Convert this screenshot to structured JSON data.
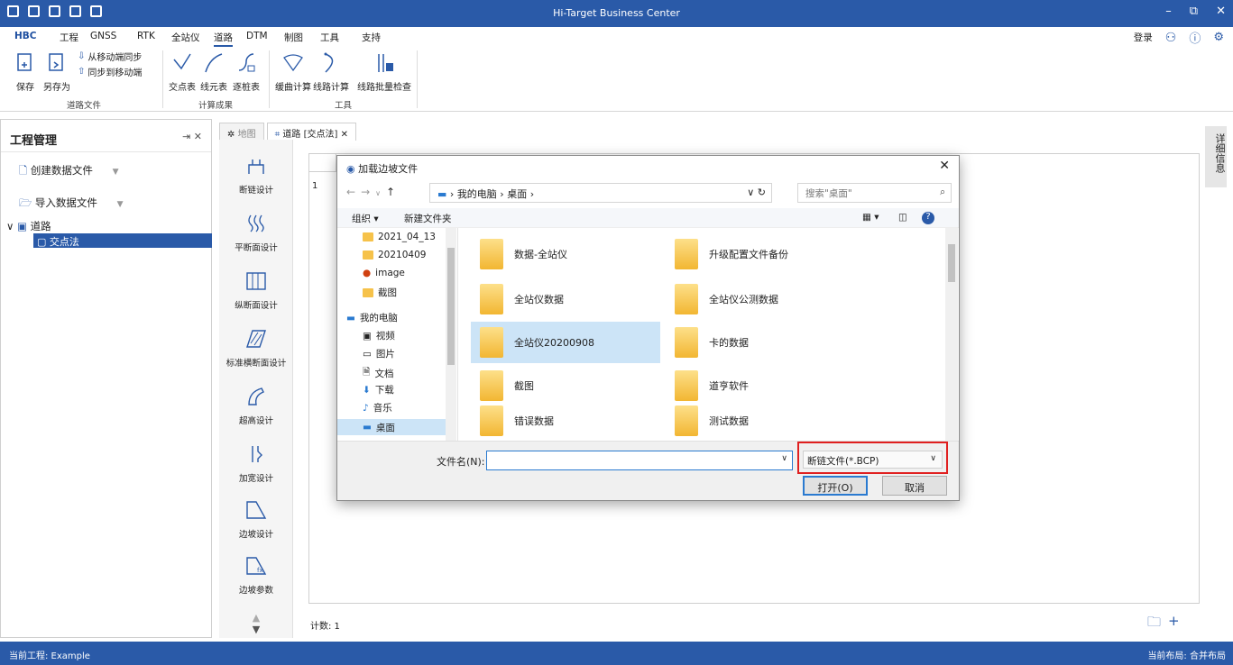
{
  "app": {
    "title": "Hi-Target Business Center"
  },
  "menu": [
    "HBC",
    "工程",
    "GNSS",
    "RTK",
    "全站仪",
    "道路",
    "DTM",
    "制图",
    "工具",
    "支持"
  ],
  "menu_active": "道路",
  "top_right": {
    "login": "登录"
  },
  "ribbon": {
    "save": "保存",
    "save_as": "另存为",
    "sync_from": "从移动端同步",
    "sync_to": "同步到移动端",
    "group_file": "道路文件",
    "jd_table": "交点表",
    "line_table": "线元表",
    "pile_table": "逐桩表",
    "group_result": "计算成果",
    "curve_calc": "缓曲计算",
    "route_calc": "线路计算",
    "batch_check": "线路批量检查",
    "group_tools": "工具"
  },
  "left_panel": {
    "title": "工程管理",
    "create_data": "创建数据文件",
    "import_data": "导入数据文件",
    "tree_road": "道路",
    "tree_jd": "交点法"
  },
  "tabs": [
    "地图",
    "道路 [交点法]"
  ],
  "tools": [
    "断链设计",
    "平断面设计",
    "纵断面设计",
    "标准横断面设计",
    "超高设计",
    "加宽设计",
    "边坡设计",
    "边坡参数"
  ],
  "grid_first_row": "1",
  "count": "计数: 1",
  "right_strip": "详细信息",
  "status": {
    "project": "当前工程: Example",
    "layout": "当前布局: 合并布局"
  },
  "dialog": {
    "title": "加载边坡文件",
    "path": [
      "我的电脑",
      "桌面"
    ],
    "search_placeholder": "搜索\"桌面\"",
    "organize": "组织 ▾",
    "new_folder": "新建文件夹",
    "nav": [
      "2021_04_13",
      "20210409",
      "image",
      "截图",
      "我的电脑",
      "视频",
      "图片",
      "文档",
      "下载",
      "音乐",
      "桌面"
    ],
    "files": [
      "数据-全站仪",
      "升级配置文件备份",
      "全站仪数据",
      "全站仪公测数据",
      "全站仪20200908",
      "卡的数据",
      "截图",
      "道亨软件",
      "错误数据",
      "测试数据"
    ],
    "filename_label": "文件名(N):",
    "filetype": "断链文件(*.BCP)",
    "open": "打开(O)",
    "cancel": "取消"
  },
  "colors": {
    "accent": "#2a5aa8",
    "highlight_box": "#e02020",
    "selection": "#cce4f7"
  }
}
